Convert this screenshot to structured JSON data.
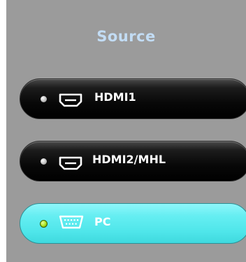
{
  "title": "Source",
  "sources": [
    {
      "label": "HDMI1",
      "icon": "hdmi-port-icon",
      "selected": false
    },
    {
      "label": "HDMI2/MHL",
      "icon": "hdmi-port-icon",
      "selected": false
    },
    {
      "label": "PC",
      "icon": "vga-port-icon",
      "selected": true
    }
  ],
  "colors": {
    "panel_background": "#9b9b9b",
    "title_color": "#c2dcf4",
    "button_dark": "#0a0a0a",
    "button_active": "#5eecf0",
    "indicator_active": "#a7e21c",
    "indicator_inactive": "#cfcfcf",
    "label_color": "#ffffff"
  }
}
